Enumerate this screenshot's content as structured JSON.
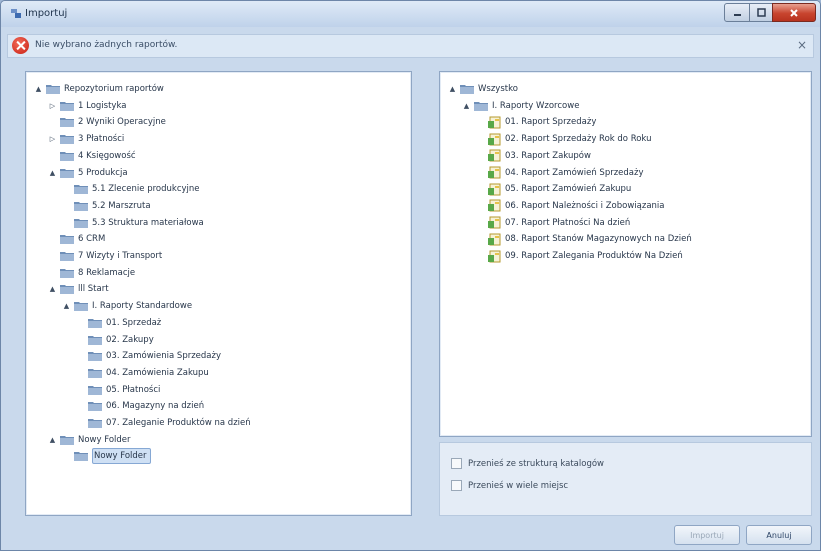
{
  "window": {
    "title": "Importuj"
  },
  "error": {
    "message": "Nie wybrano żadnych raportów.",
    "close_glyph": "×"
  },
  "left_tree": [
    {
      "label": "Repozytorium raportów",
      "expander": "▲"
    },
    {
      "label": "1 Logistyka",
      "expander": "▷"
    },
    {
      "label": "2 Wyniki Operacyjne",
      "expander": ""
    },
    {
      "label": "3 Płatności",
      "expander": "▷"
    },
    {
      "label": "4 Księgowość",
      "expander": ""
    },
    {
      "label": "5 Produkcja",
      "expander": "▲"
    },
    {
      "label": "5.1 Zlecenie produkcyjne",
      "expander": ""
    },
    {
      "label": "5.2 Marszruta",
      "expander": ""
    },
    {
      "label": "5.3 Struktura materiałowa",
      "expander": ""
    },
    {
      "label": "6 CRM",
      "expander": ""
    },
    {
      "label": "7 Wizyty i Transport",
      "expander": ""
    },
    {
      "label": "8 Reklamacje",
      "expander": ""
    },
    {
      "label": "lll Start",
      "expander": "▲"
    },
    {
      "label": "I. Raporty Standardowe",
      "expander": "▲"
    },
    {
      "label": "01. Sprzedaż",
      "expander": ""
    },
    {
      "label": "02. Zakupy",
      "expander": ""
    },
    {
      "label": "03. Zamówienia Sprzedaży",
      "expander": ""
    },
    {
      "label": "04. Zamówienia Zakupu",
      "expander": ""
    },
    {
      "label": "05. Płatności",
      "expander": ""
    },
    {
      "label": "06. Magazyny na dzień",
      "expander": ""
    },
    {
      "label": "07. Zaleganie Produktów na dzień",
      "expander": ""
    },
    {
      "label": "Nowy Folder",
      "expander": "▲"
    },
    {
      "label": "Nowy Folder",
      "expander": "",
      "selected": true
    }
  ],
  "right_tree": [
    {
      "label": "Wszystko",
      "expander": "▲",
      "kind": "folder"
    },
    {
      "label": "I. Raporty Wzorcowe",
      "expander": "▲",
      "kind": "folder"
    },
    {
      "label": "01. Raport Sprzedaży",
      "kind": "report"
    },
    {
      "label": "02. Raport Sprzedaży Rok do Roku",
      "kind": "report"
    },
    {
      "label": "03. Raport Zakupów",
      "kind": "report"
    },
    {
      "label": "04. Raport Zamówień Sprzedaży",
      "kind": "report"
    },
    {
      "label": "05. Raport Zamówień Zakupu",
      "kind": "report"
    },
    {
      "label": "06. Raport Należności i Zobowiązania",
      "kind": "report"
    },
    {
      "label": "07. Raport Płatności Na dzień",
      "kind": "report"
    },
    {
      "label": "08. Raport Stanów Magazynowych na Dzień",
      "kind": "report"
    },
    {
      "label": "09. Raport Zalegania Produktów Na Dzień",
      "kind": "report"
    }
  ],
  "options": {
    "with_structure": "Przenieś ze strukturą katalogów",
    "multiple_places": "Przenieś w wiele miejsc"
  },
  "buttons": {
    "import": "Importuj",
    "cancel": "Anuluj"
  },
  "colors": {
    "folder": "#6f8fb8",
    "report": "#e6c24a",
    "error": "#c81f12"
  }
}
